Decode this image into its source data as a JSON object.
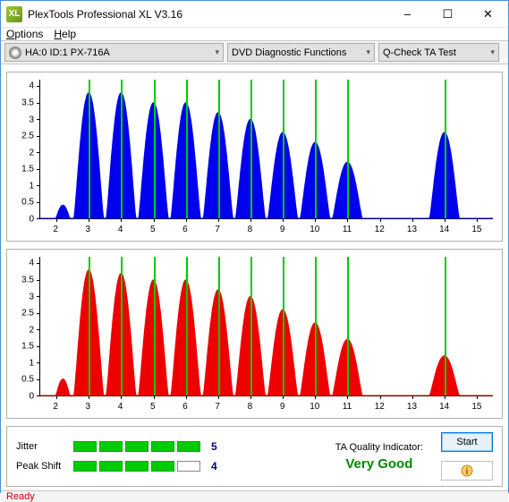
{
  "titlebar": {
    "title": "PlexTools Professional XL V3.16",
    "icon_text": "XL"
  },
  "menubar": {
    "options": "Options",
    "help": "Help"
  },
  "toolbar": {
    "c1": "HA:0 ID:1   PX-716A",
    "c2": "DVD Diagnostic Functions",
    "c3": "Q-Check TA Test"
  },
  "metrics": {
    "jitter_label": "Jitter",
    "jitter_value": "5",
    "jitter_filled": 5,
    "peak_label": "Peak Shift",
    "peak_value": "4",
    "peak_filled": 4,
    "total_blocks": 5
  },
  "quality": {
    "label": "TA Quality Indicator:",
    "value": "Very Good"
  },
  "buttons": {
    "start": "Start"
  },
  "statusbar": {
    "text": "Ready"
  },
  "chart_data": [
    {
      "type": "line",
      "color": "#0000ee",
      "xlim": [
        1.5,
        15.5
      ],
      "ylim": [
        0,
        4.2
      ],
      "yticks": [
        0,
        0.5,
        1,
        1.5,
        2,
        2.5,
        3,
        3.5,
        4
      ],
      "xticks": [
        2,
        3,
        4,
        5,
        6,
        7,
        8,
        9,
        10,
        11,
        12,
        13,
        14,
        15
      ],
      "vlines": [
        3,
        4,
        5,
        6,
        7,
        8,
        9,
        10,
        11,
        14
      ],
      "peaks": [
        {
          "x": 3,
          "y": 3.8
        },
        {
          "x": 4,
          "y": 3.8
        },
        {
          "x": 5,
          "y": 3.5
        },
        {
          "x": 6,
          "y": 3.5
        },
        {
          "x": 7,
          "y": 3.2
        },
        {
          "x": 8,
          "y": 3.0
        },
        {
          "x": 9,
          "y": 2.6
        },
        {
          "x": 10,
          "y": 2.3
        },
        {
          "x": 11,
          "y": 1.7
        },
        {
          "x": 14,
          "y": 2.6
        }
      ],
      "bump": {
        "x": 2.2,
        "y": 0.4
      }
    },
    {
      "type": "line",
      "color": "#ee0000",
      "xlim": [
        1.5,
        15.5
      ],
      "ylim": [
        0,
        4.2
      ],
      "yticks": [
        0,
        0.5,
        1,
        1.5,
        2,
        2.5,
        3,
        3.5,
        4
      ],
      "xticks": [
        2,
        3,
        4,
        5,
        6,
        7,
        8,
        9,
        10,
        11,
        12,
        13,
        14,
        15
      ],
      "vlines": [
        3,
        4,
        5,
        6,
        7,
        8,
        9,
        10,
        11,
        14
      ],
      "peaks": [
        {
          "x": 3,
          "y": 3.8
        },
        {
          "x": 4,
          "y": 3.7
        },
        {
          "x": 5,
          "y": 3.5
        },
        {
          "x": 6,
          "y": 3.5
        },
        {
          "x": 7,
          "y": 3.2
        },
        {
          "x": 8,
          "y": 3.0
        },
        {
          "x": 9,
          "y": 2.6
        },
        {
          "x": 10,
          "y": 2.2
        },
        {
          "x": 11,
          "y": 1.7
        },
        {
          "x": 14,
          "y": 1.2
        }
      ],
      "bump": {
        "x": 2.2,
        "y": 0.5
      }
    }
  ]
}
